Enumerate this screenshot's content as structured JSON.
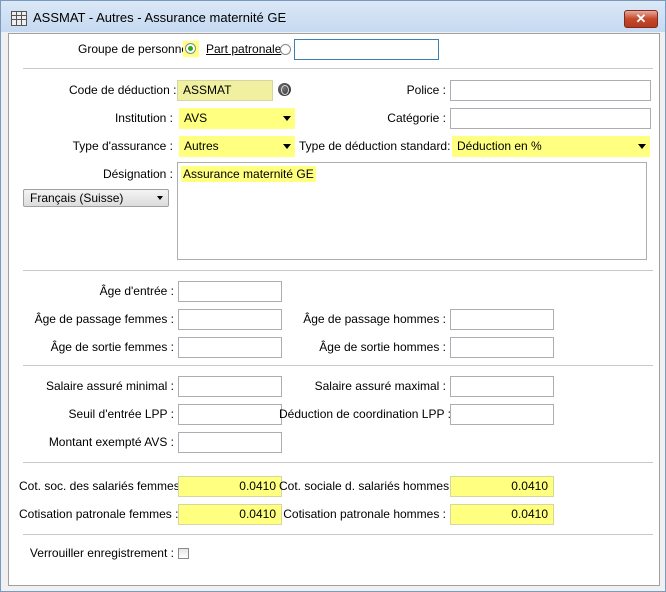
{
  "window": {
    "title": "ASSMAT - Autres - Assurance maternité GE",
    "close_label": "✕"
  },
  "group": {
    "label": "Groupe de personnes",
    "part_label": "Part patronale",
    "selected": "Groupe de personnes",
    "input_value": ""
  },
  "main": {
    "code_label": "Code de déduction :",
    "code_value": "ASSMAT",
    "police_label": "Police :",
    "police_value": "",
    "institution_label": "Institution :",
    "institution_value": "AVS",
    "categorie_label": "Catégorie :",
    "categorie_value": "",
    "type_ass_label": "Type d'assurance :",
    "type_ass_value": "Autres",
    "type_ded_label": "Type de déduction standard:",
    "type_ded_value": "Déduction en %",
    "designation_label": "Désignation :",
    "designation_value": "Assurance maternité GE",
    "language_value": "Français (Suisse)"
  },
  "ages": {
    "entree_label": "Âge d'entrée :",
    "passage_f_label": "Âge de passage femmes :",
    "passage_h_label": "Âge de passage hommes :",
    "sortie_f_label": "Âge de sortie femmes :",
    "sortie_h_label": "Âge de sortie hommes :"
  },
  "salaires": {
    "min_label": "Salaire assuré minimal :",
    "max_label": "Salaire assuré maximal :",
    "seuil_label": "Seuil d'entrée LPP :",
    "coord_label": "Déduction de coordination LPP :",
    "exempte_label": "Montant exempté AVS :"
  },
  "cotisations": {
    "sal_f_label": "Cot. soc. des salariés femmes :",
    "sal_f_value": "0.0410",
    "sal_h_label": "Cot. sociale d. salariés hommes :",
    "sal_h_value": "0.0410",
    "pat_f_label": "Cotisation patronale femmes :",
    "pat_f_value": "0.0410",
    "pat_h_label": "Cotisation patronale hommes :",
    "pat_h_value": "0.0410"
  },
  "lock": {
    "label": "Verrouiller enregistrement :",
    "checked": false
  },
  "colors": {
    "highlight": "#ffff80",
    "title_bg": "#c5d9f1",
    "close_bg": "#c4482c"
  }
}
